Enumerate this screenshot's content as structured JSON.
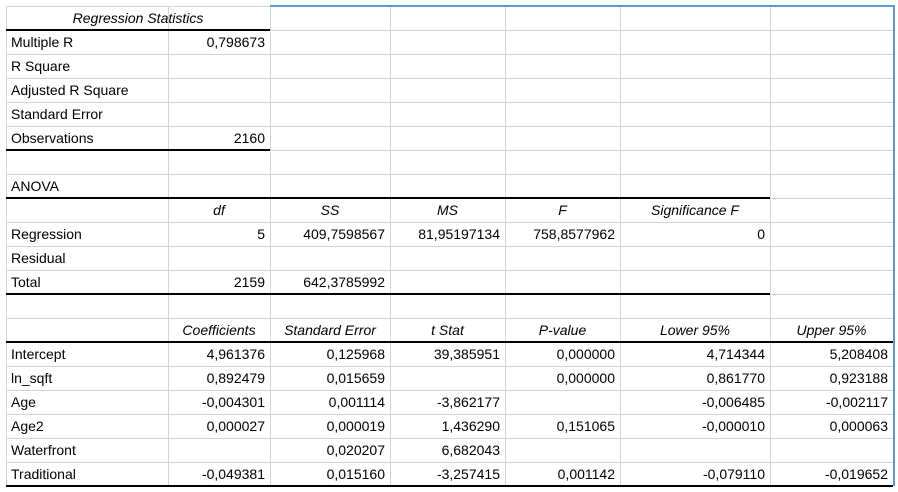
{
  "regression_statistics": {
    "title": "Regression Statistics",
    "rows": [
      {
        "label": "Multiple R",
        "value": "0,798673"
      },
      {
        "label": "R Square",
        "value": ""
      },
      {
        "label": "Adjusted R Square",
        "value": ""
      },
      {
        "label": "Standard Error",
        "value": ""
      },
      {
        "label": "Observations",
        "value": "2160"
      }
    ]
  },
  "anova": {
    "title": "ANOVA",
    "headers": [
      "",
      "df",
      "SS",
      "MS",
      "F",
      "Significance F"
    ],
    "rows": [
      {
        "label": "Regression",
        "df": "5",
        "ss": "409,7598567",
        "ms": "81,95197134",
        "f": "758,8577962",
        "sig": "0"
      },
      {
        "label": "Residual",
        "df": "",
        "ss": "",
        "ms": "",
        "f": "",
        "sig": ""
      },
      {
        "label": "Total",
        "df": "2159",
        "ss": "642,3785992",
        "ms": "",
        "f": "",
        "sig": ""
      }
    ]
  },
  "coefficients": {
    "headers": [
      "",
      "Coefficients",
      "Standard Error",
      "t Stat",
      "P-value",
      "Lower 95%",
      "Upper 95%"
    ],
    "rows": [
      {
        "label": "Intercept",
        "coef": "4,961376",
        "se": "0,125968",
        "t": "39,385951",
        "p": "0,000000",
        "lower": "4,714344",
        "upper": "5,208408"
      },
      {
        "label": "ln_sqft",
        "coef": "0,892479",
        "se": "0,015659",
        "t": "",
        "p": "0,000000",
        "lower": "0,861770",
        "upper": "0,923188"
      },
      {
        "label": "Age",
        "coef": "-0,004301",
        "se": "0,001114",
        "t": "-3,862177",
        "p": "",
        "lower": "-0,006485",
        "upper": "-0,002117"
      },
      {
        "label": "Age2",
        "coef": "0,000027",
        "se": "0,000019",
        "t": "1,436290",
        "p": "0,151065",
        "lower": "-0,000010",
        "upper": "0,000063"
      },
      {
        "label": "Waterfront",
        "coef": "",
        "se": "0,020207",
        "t": "6,682043",
        "p": "",
        "lower": "",
        "upper": ""
      },
      {
        "label": "Traditional",
        "coef": "-0,049381",
        "se": "0,015160",
        "t": "-3,257415",
        "p": "0,001142",
        "lower": "-0,079110",
        "upper": "-0,019652"
      }
    ]
  },
  "colors": {
    "gridline": "#d4d4d4",
    "border": "#000000",
    "frame": "#5b9bd5"
  }
}
